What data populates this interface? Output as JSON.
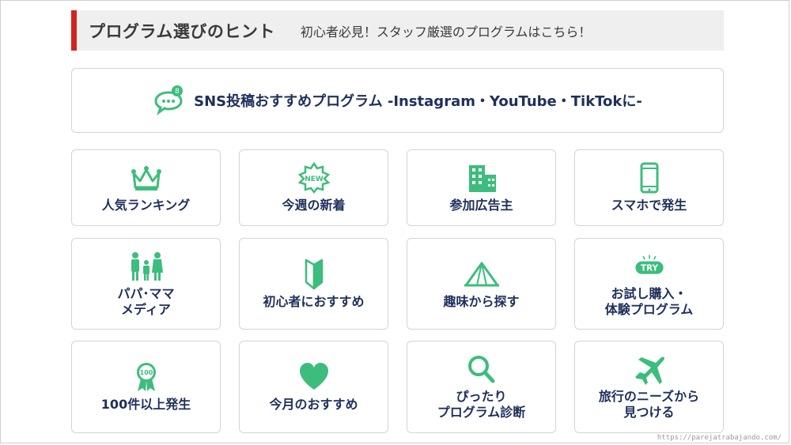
{
  "header": {
    "title": "プログラム選びのヒント",
    "subtitle": "初心者必見！スタッフ厳選のプログラムはこちら！",
    "accent_color": "#d2231e"
  },
  "sns": {
    "label": "SNS投稿おすすめプログラム -Instagram・YouTube・TikTokに-",
    "icon": "chat-bubble-icon",
    "badge": "8"
  },
  "tiles": [
    {
      "label": "人気ランキング",
      "icon": "crown-icon"
    },
    {
      "label": "今週の新着",
      "icon": "new-badge-icon",
      "badge_text": "NEW"
    },
    {
      "label": "参加広告主",
      "icon": "building-icon"
    },
    {
      "label": "スマホで発生",
      "icon": "smartphone-icon"
    },
    {
      "label": "パパ･ママ\nメディア",
      "icon": "family-icon"
    },
    {
      "label": "初心者におすすめ",
      "icon": "beginner-mark-icon"
    },
    {
      "label": "趣味から探す",
      "icon": "tent-icon"
    },
    {
      "label": "お試し購入・\n体験プログラム",
      "icon": "try-badge-icon",
      "badge_text": "TRY"
    },
    {
      "label": "100件以上発生",
      "icon": "award-ribbon-icon",
      "badge_text": "100"
    },
    {
      "label": "今月のおすすめ",
      "icon": "heart-icon"
    },
    {
      "label": "ぴったり\nプログラム診断",
      "icon": "magnifier-icon"
    },
    {
      "label": "旅行のニーズから\n見つける",
      "icon": "airplane-icon"
    }
  ],
  "icon_color": "#3dbd7d",
  "watermark": "https://parejatrabajando.com/"
}
